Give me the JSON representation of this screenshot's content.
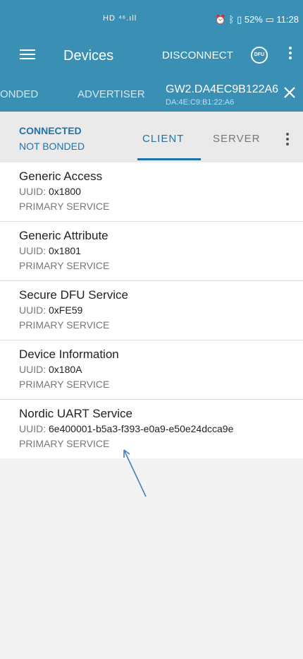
{
  "status_bar": {
    "left": "HD ⁴⁶.ıll",
    "battery": "52%",
    "time": "11:28",
    "icons": [
      "alarm-icon",
      "bluetooth-icon",
      "vibrate-icon",
      "battery-icon"
    ]
  },
  "app_bar": {
    "title": "Devices",
    "disconnect_label": "DISCONNECT",
    "dfu_label": "DFU"
  },
  "tabs": {
    "bonded": "ONDED",
    "advertiser": "ADVERTISER",
    "device_name": "GW2.DA4EC9B122A6",
    "device_address": "DA:4E:C9:B1:22:A6"
  },
  "connection": {
    "state": "CONNECTED",
    "bond": "NOT BONDED",
    "tab_client": "CLIENT",
    "tab_server": "SERVER"
  },
  "services": [
    {
      "name": "Generic Access",
      "uuid_label": "UUID:",
      "uuid": "0x1800",
      "kind": "PRIMARY SERVICE"
    },
    {
      "name": "Generic Attribute",
      "uuid_label": "UUID:",
      "uuid": "0x1801",
      "kind": "PRIMARY SERVICE"
    },
    {
      "name": "Secure DFU Service",
      "uuid_label": "UUID:",
      "uuid": "0xFE59",
      "kind": "PRIMARY SERVICE"
    },
    {
      "name": "Device Information",
      "uuid_label": "UUID:",
      "uuid": "0x180A",
      "kind": "PRIMARY SERVICE"
    },
    {
      "name": "Nordic UART Service",
      "uuid_label": "UUID:",
      "uuid": "6e400001-b5a3-f393-e0a9-e50e24dcca9e",
      "kind": "PRIMARY SERVICE"
    }
  ],
  "colors": {
    "primary": "#3a8fb5",
    "accent": "#1f73a8",
    "annotation_arrow": "#4a7fb5"
  }
}
